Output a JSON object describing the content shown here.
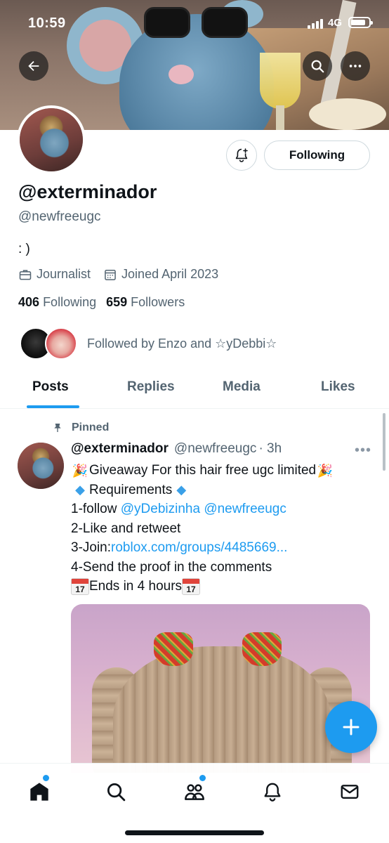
{
  "status_bar": {
    "time": "10:59",
    "network": "4G"
  },
  "profile": {
    "display_name": "@exterminador",
    "handle": "@newfreeugc",
    "bio": ": )",
    "category": "Journalist",
    "joined": "Joined April 2023",
    "following_count": "406",
    "following_label": "Following",
    "followers_count": "659",
    "followers_label": "Followers",
    "followed_by": "Followed by Enzo and ☆yDebbi☆",
    "follow_button_label": "Following"
  },
  "icons": {
    "back": "arrow-left-icon",
    "search": "search-icon",
    "more": "more-icon",
    "notify": "bell-plus-icon",
    "category": "briefcase-icon",
    "joined": "calendar-icon",
    "pin": "pin-icon",
    "compose": "plus-icon"
  },
  "tabs": [
    {
      "label": "Posts",
      "active": true
    },
    {
      "label": "Replies",
      "active": false
    },
    {
      "label": "Media",
      "active": false
    },
    {
      "label": "Likes",
      "active": false
    }
  ],
  "tweet": {
    "pinned_label": "Pinned",
    "author_name": "@exterminador",
    "author_handle": "@newfreeugc",
    "time": "· 3h",
    "line1_text": "Giveaway For this hair free ugc limited",
    "line2_text": "Requirements",
    "line3_prefix": "1-follow ",
    "line3_mention1": "@yDebizinha",
    "line3_mention2": "@newfreeugc",
    "line4": "2-Like and retweet",
    "line5_prefix": "3-Join:",
    "line5_link": "roblox.com/groups/4485669...",
    "line6": "4-Send the proof in the comments",
    "line7_text": "Ends in 4 hours",
    "calendar_emoji_day": "17"
  },
  "colors": {
    "accent": "#1d9bf0",
    "text_primary": "#0f1419",
    "text_secondary": "#536471",
    "border": "#cfd9de"
  },
  "bottom_nav": [
    "home-icon",
    "search-icon",
    "communities-icon",
    "notifications-icon",
    "messages-icon"
  ]
}
